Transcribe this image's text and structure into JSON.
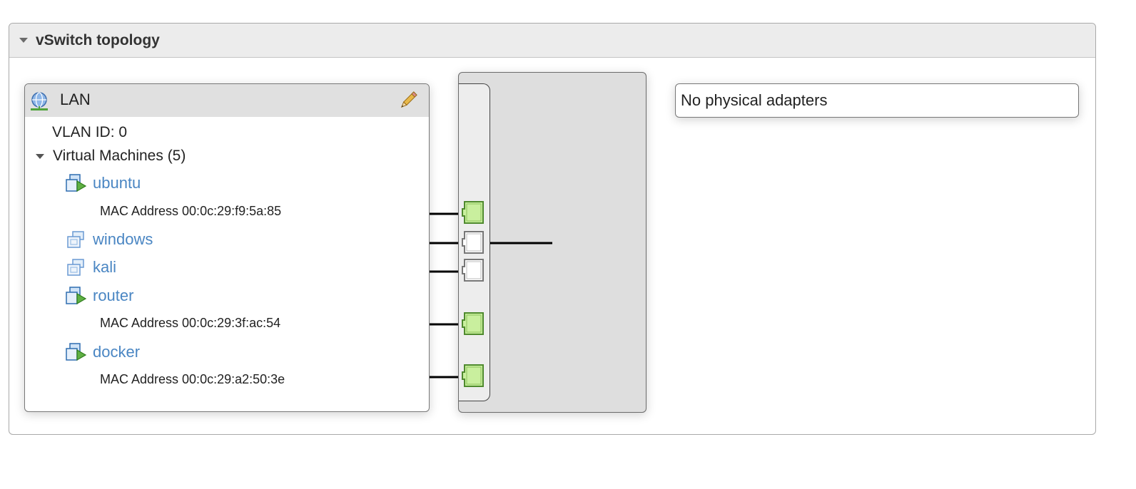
{
  "panel": {
    "title": "vSwitch topology"
  },
  "portgroup": {
    "name": "LAN",
    "vlan_text": "VLAN ID: 0",
    "vm_section_label": "Virtual Machines (5)",
    "vms": [
      {
        "name": "ubuntu",
        "state": "powered-on",
        "mac": "MAC Address 00:0c:29:f9:5a:85"
      },
      {
        "name": "windows",
        "state": "powered-off",
        "mac": ""
      },
      {
        "name": "kali",
        "state": "powered-off",
        "mac": ""
      },
      {
        "name": "router",
        "state": "powered-on",
        "mac": "MAC Address 00:0c:29:3f:ac:54"
      },
      {
        "name": "docker",
        "state": "powered-on",
        "mac": "MAC Address 00:0c:29:a2:50:3e"
      }
    ]
  },
  "ports": [
    {
      "state": "connected"
    },
    {
      "state": "disconnected"
    },
    {
      "state": "disconnected"
    },
    {
      "state": "connected"
    },
    {
      "state": "connected"
    }
  ],
  "physical_adapters": {
    "text": "No physical adapters"
  },
  "colors": {
    "link": "#4a86c3",
    "port_active": "#c9ef9e",
    "port_active_border": "#4f8a2e",
    "port_inactive": "#ffffff",
    "port_inactive_border": "#777777",
    "switch_body": "#dedede",
    "header_bg": "#ececec"
  },
  "icons": {
    "collapse": "caret-down-icon",
    "portgroup": "network-globe-icon",
    "edit": "pencil-icon",
    "vm_on": "vm-powered-on-icon",
    "vm_off": "vm-powered-off-icon",
    "port": "network-port-icon"
  }
}
